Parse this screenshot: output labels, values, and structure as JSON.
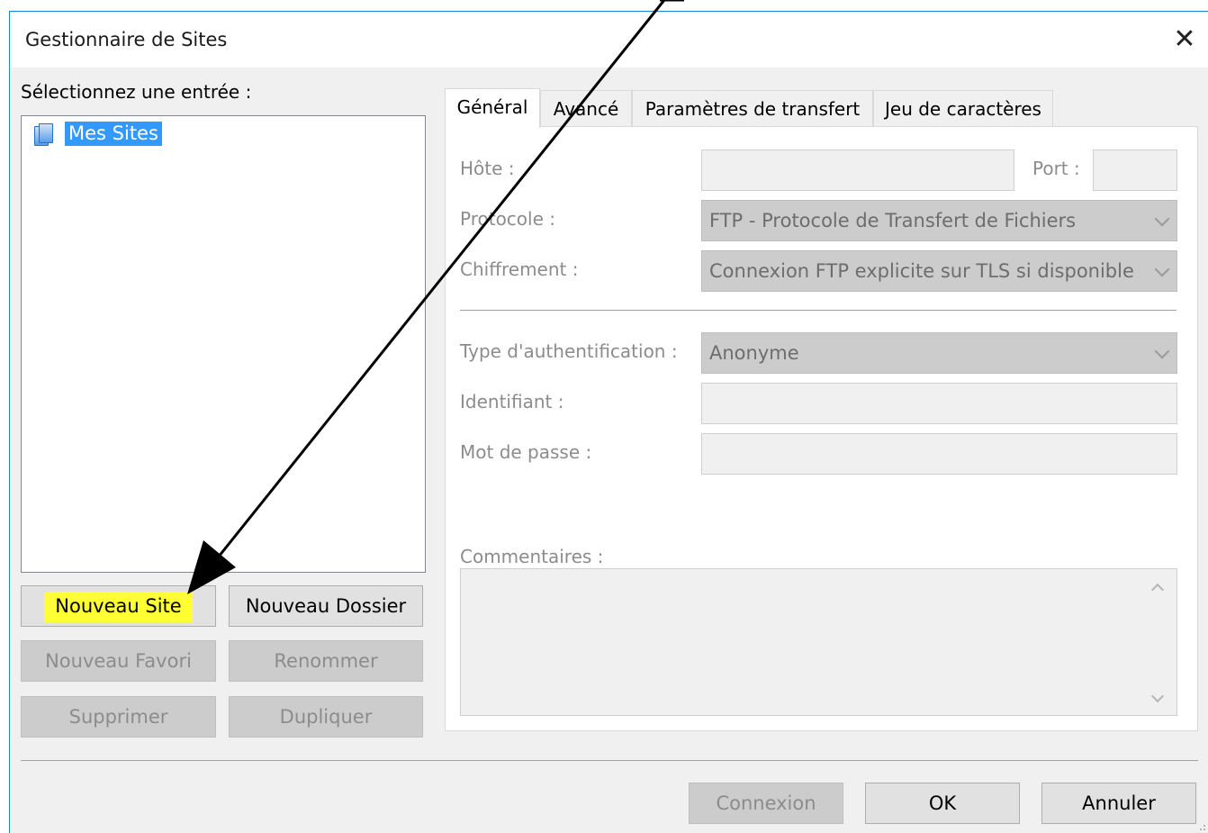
{
  "window": {
    "title": "Gestionnaire de Sites"
  },
  "left": {
    "select_label": "Sélectionnez une entrée :",
    "tree": {
      "items": [
        {
          "label": "Mes Sites",
          "icon": "sites-folder-icon",
          "selected": true
        }
      ]
    },
    "buttons": {
      "new_site": "Nouveau Site",
      "new_folder": "Nouveau Dossier",
      "new_bookmark": "Nouveau Favori",
      "rename": "Renommer",
      "delete": "Supprimer",
      "duplicate": "Dupliquer"
    }
  },
  "tabs": [
    {
      "label": "Général",
      "active": true
    },
    {
      "label": "Avancé",
      "active": false
    },
    {
      "label": "Paramètres de transfert",
      "active": false
    },
    {
      "label": "Jeu de caractères",
      "active": false
    }
  ],
  "general": {
    "host_label": "Hôte :",
    "host_value": "",
    "port_label": "Port :",
    "port_value": "",
    "protocol_label": "Protocole :",
    "protocol_value": "FTP - Protocole de Transfert de Fichiers",
    "encryption_label": "Chiffrement :",
    "encryption_value": "Connexion FTP explicite sur TLS si disponible",
    "auth_label": "Type d'authentification :",
    "auth_value": "Anonyme",
    "user_label": "Identifiant :",
    "user_value": "",
    "password_label": "Mot de passe :",
    "password_value": "",
    "comments_label": "Commentaires :",
    "comments_value": ""
  },
  "footer": {
    "connect": "Connexion",
    "ok": "OK",
    "cancel": "Annuler"
  },
  "colors": {
    "selection": "#3399ff",
    "highlight": "#ffff33",
    "window_border": "#1883d7"
  }
}
